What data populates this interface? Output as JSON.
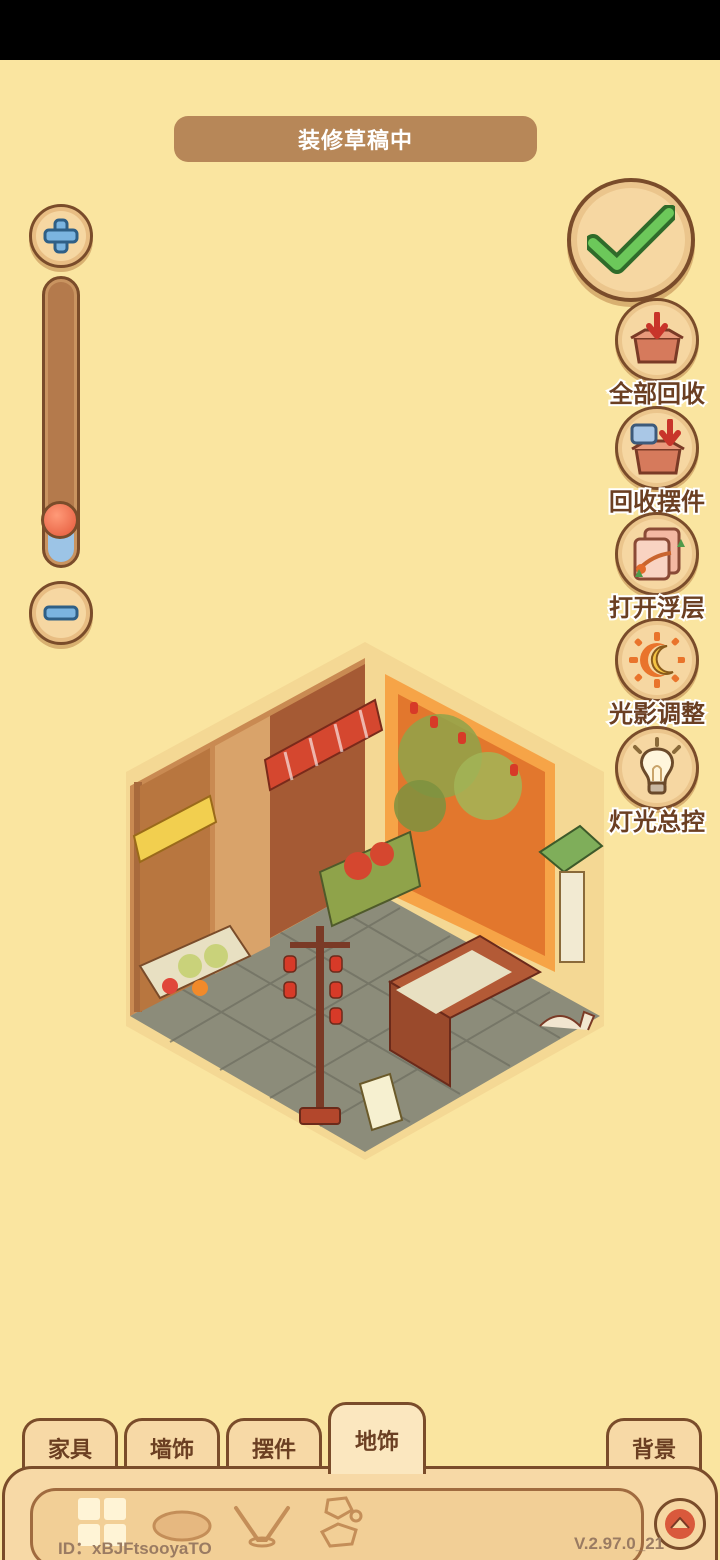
{
  "status": "装修草稿中",
  "tools": [
    {
      "label": "全部回收",
      "icon": "box-recycle-icon"
    },
    {
      "label": "回收摆件",
      "icon": "box-recycle-item-icon"
    },
    {
      "label": "打开浮层",
      "icon": "layer-icon"
    },
    {
      "label": "光影调整",
      "icon": "sun-moon-icon"
    },
    {
      "label": "灯光总控",
      "icon": "lightbulb-icon"
    }
  ],
  "zoom": {
    "level": 0.12
  },
  "tabs": [
    {
      "label": "家具"
    },
    {
      "label": "墙饰"
    },
    {
      "label": "摆件"
    },
    {
      "label": "地饰",
      "active": true
    },
    {
      "label": "背景"
    }
  ],
  "footer": {
    "id": "ID：xBJFtsooyaTO",
    "version": "V.2.97.0_21"
  },
  "colors": {
    "background": "#fae5a0",
    "brown": "#7a4c2a",
    "confirm": "#5cba4a"
  }
}
